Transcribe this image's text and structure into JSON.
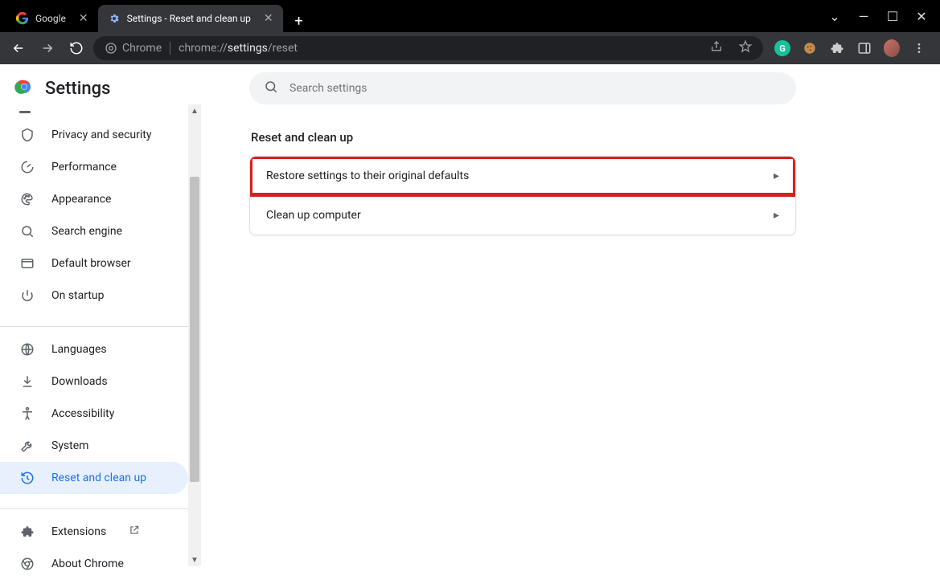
{
  "window": {
    "tabs": [
      {
        "title": "Google",
        "active": false
      },
      {
        "title": "Settings - Reset and clean up",
        "active": true
      }
    ]
  },
  "toolbar": {
    "chrome_label": "Chrome",
    "url_prefix": "chrome://",
    "url_bold": "settings",
    "url_suffix": "/reset"
  },
  "sidebar": {
    "title": "Settings",
    "items": [
      {
        "icon": "shield",
        "label": "Privacy and security"
      },
      {
        "icon": "gauge",
        "label": "Performance"
      },
      {
        "icon": "palette",
        "label": "Appearance"
      },
      {
        "icon": "search",
        "label": "Search engine"
      },
      {
        "icon": "browser",
        "label": "Default browser"
      },
      {
        "icon": "power",
        "label": "On startup"
      }
    ],
    "items2": [
      {
        "icon": "globe",
        "label": "Languages"
      },
      {
        "icon": "download",
        "label": "Downloads"
      },
      {
        "icon": "accessibility",
        "label": "Accessibility"
      },
      {
        "icon": "wrench",
        "label": "System"
      },
      {
        "icon": "history",
        "label": "Reset and clean up",
        "selected": true
      }
    ],
    "items3": [
      {
        "icon": "puzzle",
        "label": "Extensions",
        "ext": true
      },
      {
        "icon": "chrome",
        "label": "About Chrome"
      }
    ]
  },
  "main": {
    "search_placeholder": "Search settings",
    "section_title": "Reset and clean up",
    "rows": [
      {
        "label": "Restore settings to their original defaults",
        "highlight": true
      },
      {
        "label": "Clean up computer",
        "highlight": false
      }
    ]
  }
}
